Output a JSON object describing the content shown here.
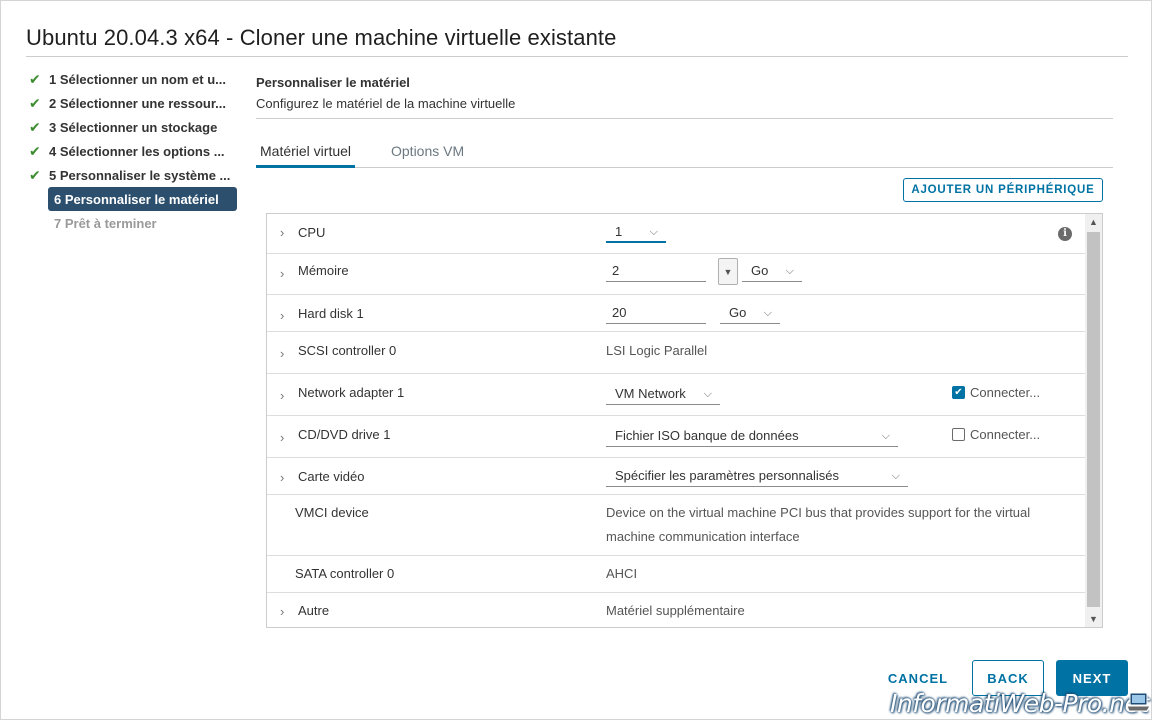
{
  "dialog": {
    "title": "Ubuntu 20.04.3 x64 - Cloner une machine virtuelle existante"
  },
  "steps": [
    {
      "label": "1 Sélectionner un nom et u...",
      "state": "done"
    },
    {
      "label": "2 Sélectionner une ressour...",
      "state": "done"
    },
    {
      "label": "3 Sélectionner un stockage",
      "state": "done"
    },
    {
      "label": "4 Sélectionner les options ...",
      "state": "done"
    },
    {
      "label": "5 Personnaliser le système ...",
      "state": "done"
    },
    {
      "label": "6 Personnaliser le matériel",
      "state": "active"
    },
    {
      "label": "7 Prêt à terminer",
      "state": "disabled"
    }
  ],
  "section": {
    "title": "Personnaliser le matériel",
    "subtitle": "Configurez le matériel de la machine virtuelle"
  },
  "tabs": [
    {
      "label": "Matériel virtuel",
      "active": true
    },
    {
      "label": "Options VM",
      "active": false
    }
  ],
  "add_device_label": "AJOUTER UN PÉRIPHÉRIQUE",
  "hardware": {
    "cpu": {
      "name": "CPU",
      "value": "1"
    },
    "memory": {
      "name": "Mémoire",
      "value": "2",
      "unit": "Go"
    },
    "hard_disk": {
      "name": "Hard disk 1",
      "value": "20",
      "unit": "Go"
    },
    "scsi": {
      "name": "SCSI controller 0",
      "value": "LSI Logic Parallel"
    },
    "network": {
      "name": "Network adapter 1",
      "value": "VM Network",
      "connect_label": "Connecter...",
      "connected": true
    },
    "cdrom": {
      "name": "CD/DVD drive 1",
      "value": "Fichier ISO banque de données",
      "connect_label": "Connecter...",
      "connected": false
    },
    "video": {
      "name": "Carte vidéo",
      "value": "Spécifier les paramètres personnalisés"
    },
    "vmci": {
      "name": "VMCI device",
      "value_line1": "Device on the virtual machine PCI bus that provides support for the virtual",
      "value_line2": "machine communication interface"
    },
    "sata": {
      "name": "SATA controller 0",
      "value": "AHCI"
    },
    "other": {
      "name": "Autre",
      "value": "Matériel supplémentaire"
    }
  },
  "footer": {
    "cancel": "CANCEL",
    "back": "BACK",
    "next": "NEXT"
  },
  "watermark": "InformatiWeb-Pro.net",
  "colors": {
    "accent": "#0072a3",
    "active_step": "#2d4f6e",
    "check": "#3c8d2f"
  }
}
